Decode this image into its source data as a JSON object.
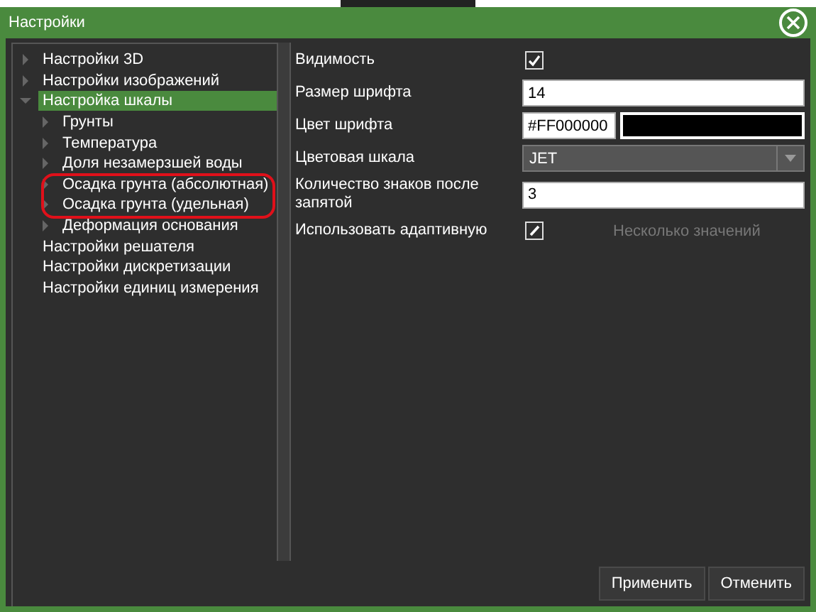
{
  "window": {
    "title": "Настройки"
  },
  "tree": [
    {
      "label": "Настройки 3D",
      "expanded": false,
      "selected": false
    },
    {
      "label": "Настройки изображений",
      "expanded": false,
      "selected": false
    },
    {
      "label": "Настройка шкалы",
      "expanded": true,
      "selected": true,
      "children": [
        {
          "label": "Грунты",
          "expanded": false,
          "selected": false
        },
        {
          "label": "Температура",
          "expanded": false,
          "selected": false
        },
        {
          "label": "Доля незамерзшей воды",
          "expanded": false,
          "selected": false
        },
        {
          "label": "Осадка грунта (абсолютная)",
          "expanded": false,
          "selected": false,
          "circled": true
        },
        {
          "label": "Осадка грунта (удельная)",
          "expanded": false,
          "selected": false,
          "circled": true
        },
        {
          "label": "Деформация основания",
          "expanded": false,
          "selected": false
        }
      ]
    },
    {
      "label": "Настройки решателя",
      "selected": false
    },
    {
      "label": "Настройки дискретизации",
      "selected": false
    },
    {
      "label": "Настройки единиц измерения",
      "selected": false
    }
  ],
  "properties": [
    {
      "kind": "checkbox",
      "label": "Видимость",
      "checked": true
    },
    {
      "kind": "text",
      "label": "Размер шрифта",
      "value": "14"
    },
    {
      "kind": "color",
      "label": "Цвет шрифта",
      "value": "#FF000000",
      "color": "#000000"
    },
    {
      "kind": "select",
      "label": "Цветовая шкала",
      "value": "JET"
    },
    {
      "kind": "text",
      "label": "Количество знаков после запятой",
      "value": "3"
    },
    {
      "kind": "checkbox",
      "label": "Использовать адаптивную",
      "checked": true,
      "mixed": true,
      "note": "Несколько значений"
    }
  ],
  "buttons": [
    "Применить",
    "Отменить"
  ]
}
